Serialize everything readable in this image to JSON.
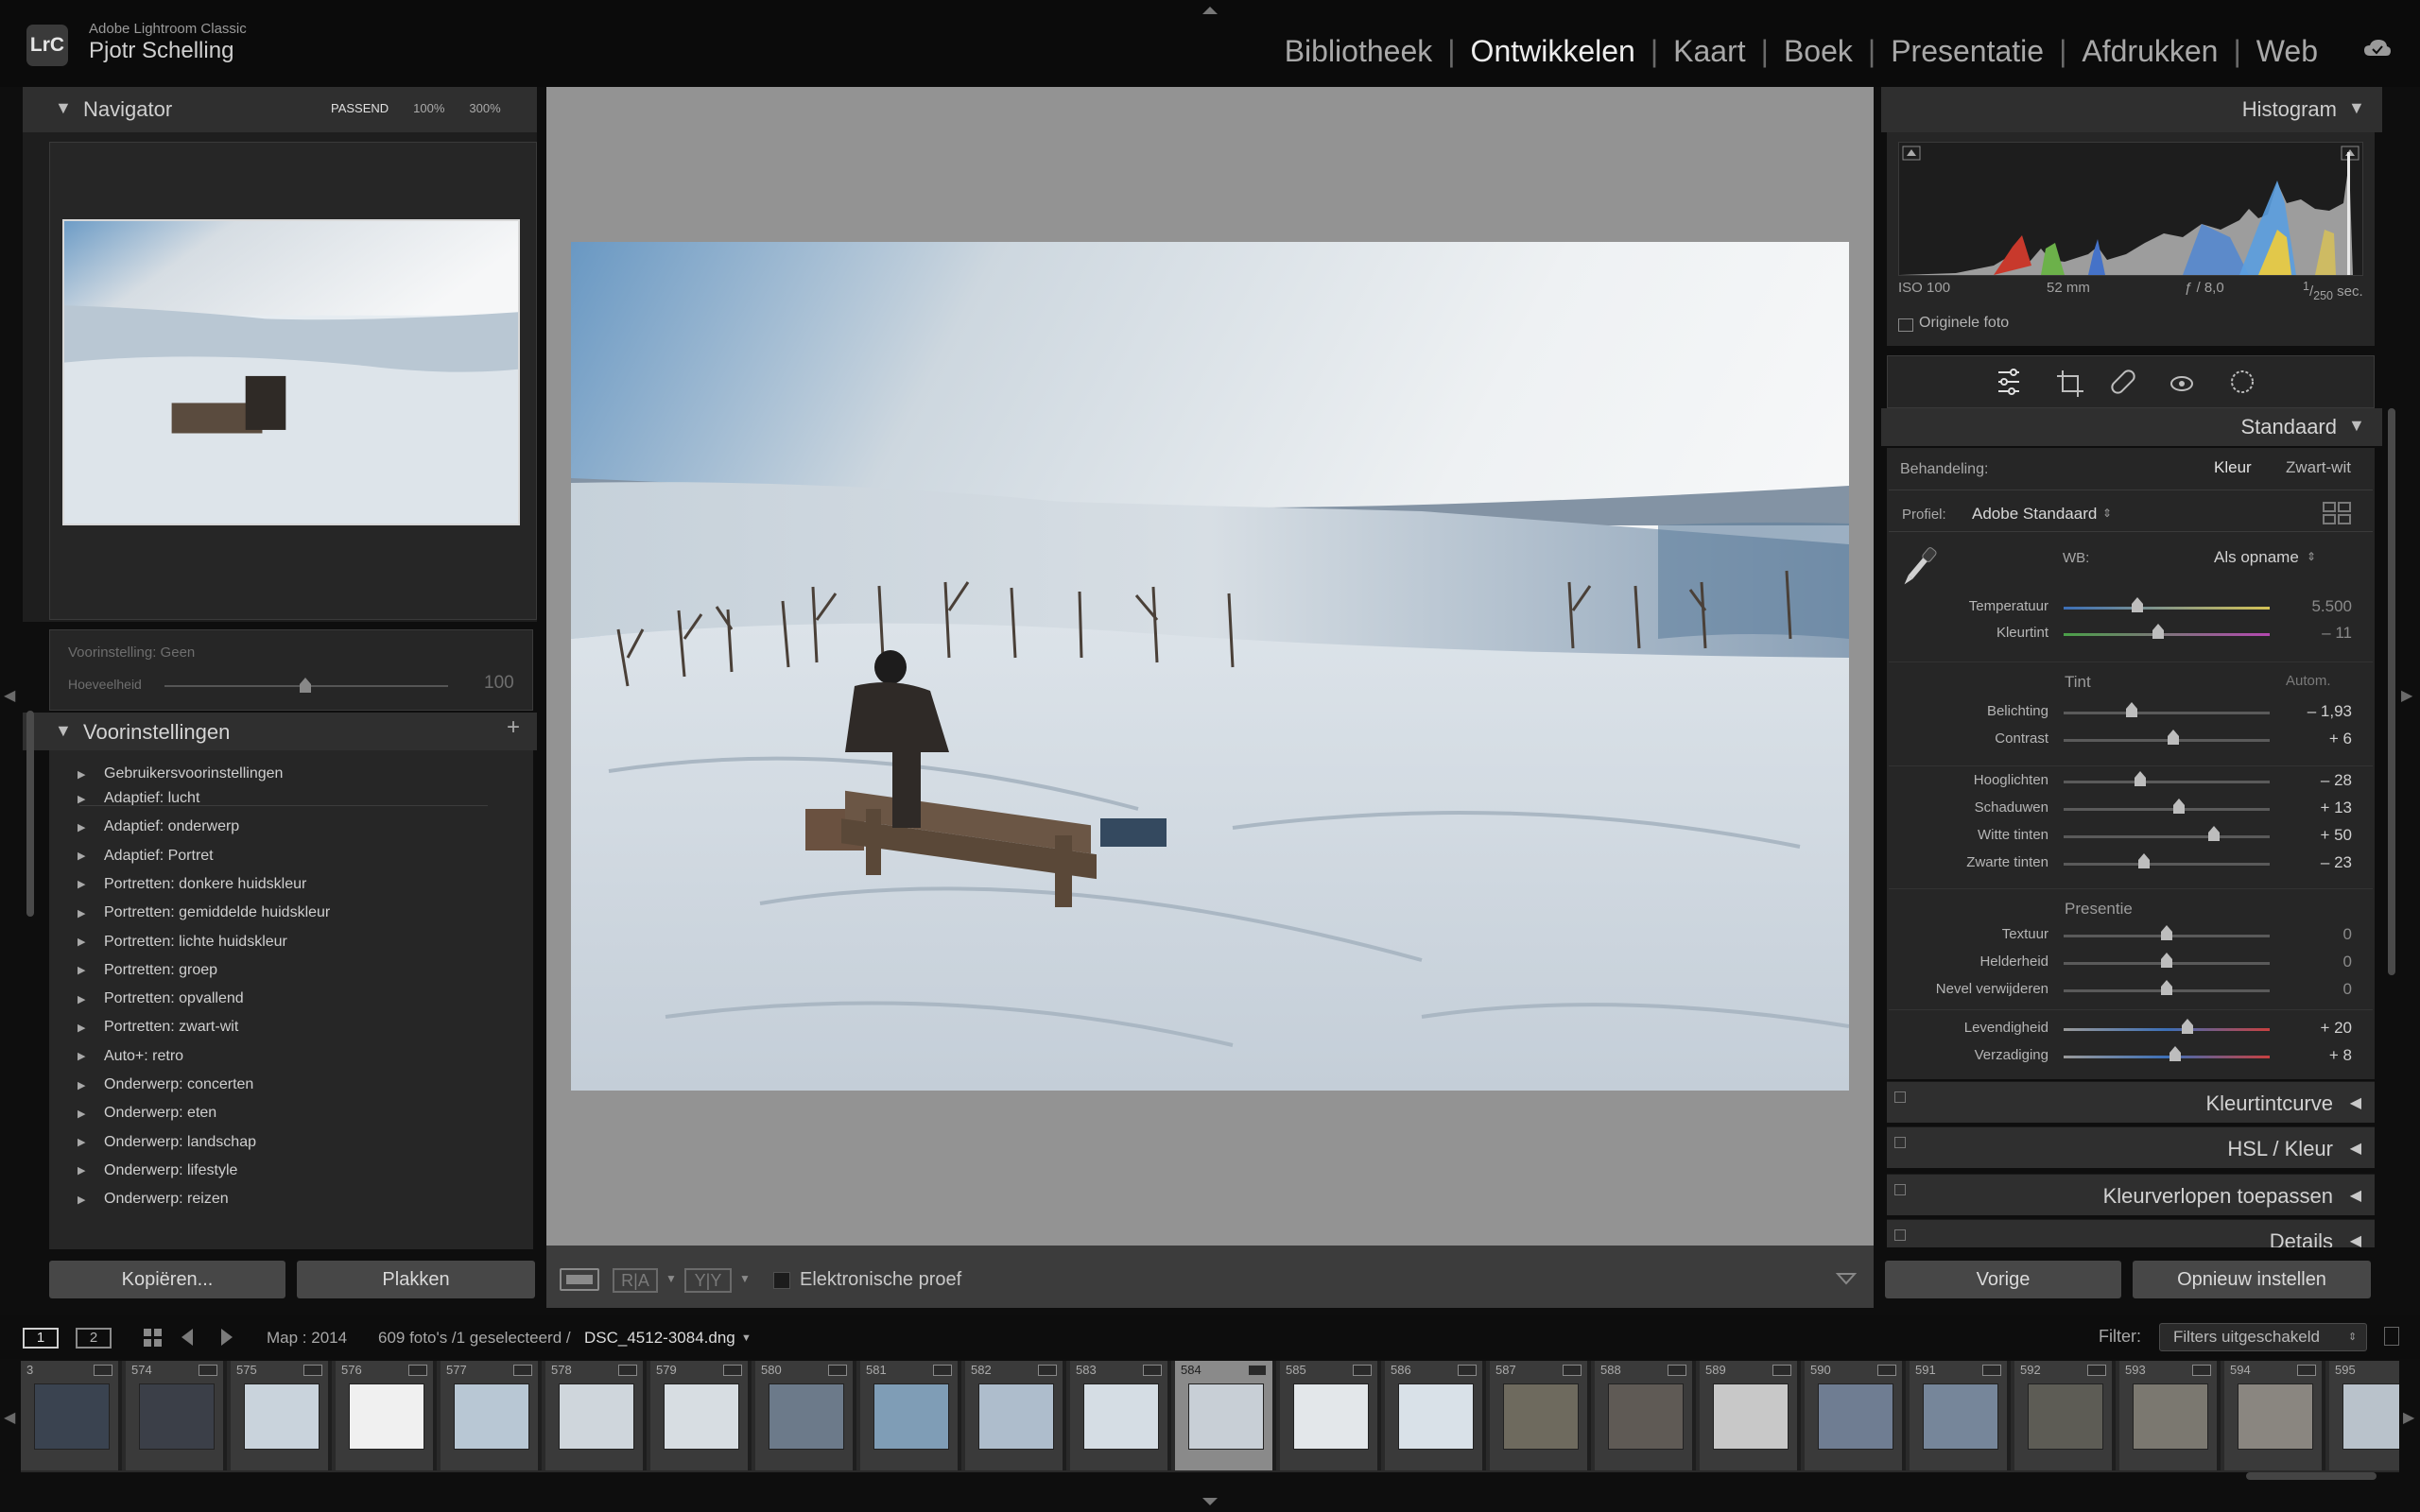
{
  "app": {
    "short": "LrC",
    "name": "Adobe Lightroom Classic",
    "user": "Pjotr Schelling"
  },
  "modules": [
    {
      "label": "Bibliotheek",
      "active": false
    },
    {
      "label": "Ontwikkelen",
      "active": true
    },
    {
      "label": "Kaart",
      "active": false
    },
    {
      "label": "Boek",
      "active": false
    },
    {
      "label": "Presentatie",
      "active": false
    },
    {
      "label": "Afdrukken",
      "active": false
    },
    {
      "label": "Web",
      "active": false
    }
  ],
  "navigator": {
    "title": "Navigator",
    "zoom": [
      "PASSEND",
      "100%",
      "300%"
    ]
  },
  "preset_amount": {
    "preset": "Voorinstelling: Geen",
    "label": "Hoeveelheid",
    "value": "100"
  },
  "presets": {
    "title": "Voorinstellingen",
    "group_top": "Gebruikersvoorinstellingen",
    "items": [
      "Adaptief: lucht",
      "Adaptief: onderwerp",
      "Adaptief: Portret",
      "Portretten: donkere huidskleur",
      "Portretten: gemiddelde huidskleur",
      "Portretten: lichte huidskleur",
      "Portretten: groep",
      "Portretten: opvallend",
      "Portretten: zwart-wit",
      "Auto+: retro",
      "Onderwerp: concerten",
      "Onderwerp: eten",
      "Onderwerp: landschap",
      "Onderwerp: lifestyle",
      "Onderwerp: reizen"
    ]
  },
  "left_buttons": {
    "copy": "Kopiëren...",
    "paste": "Plakken"
  },
  "toolbar": {
    "ra": "R|A",
    "yy": "Y|Y",
    "proof": "Elektronische proef"
  },
  "histogram": {
    "title": "Histogram",
    "iso": "ISO 100",
    "focal": "52 mm",
    "aperture": "ƒ / 8,0",
    "shutter_num": "1",
    "shutter_den": "250",
    "shutter_unit": "sec.",
    "original": "Originele foto"
  },
  "basic": {
    "title": "Standaard",
    "treatment_label": "Behandeling:",
    "treatment_color": "Kleur",
    "treatment_bw": "Zwart-wit",
    "profile_label": "Profiel:",
    "profile_value": "Adobe Standaard",
    "wb_label": "WB:",
    "wb_value": "Als opname",
    "tone_label": "Tint",
    "auto_label": "Autom.",
    "presence_label": "Presentie"
  },
  "sliders": [
    {
      "label": "Temperatuur",
      "value": "5.500",
      "pos": 0.36,
      "muted": true
    },
    {
      "label": "Kleurtint",
      "value": "– 11",
      "pos": 0.46,
      "muted": true
    },
    {
      "label": "Belichting",
      "value": "– 1,93",
      "pos": 0.33
    },
    {
      "label": "Contrast",
      "value": "+ 6",
      "pos": 0.53
    },
    {
      "label": "Hooglichten",
      "value": "– 28",
      "pos": 0.37
    },
    {
      "label": "Schaduwen",
      "value": "+ 13",
      "pos": 0.56
    },
    {
      "label": "Witte tinten",
      "value": "+ 50",
      "pos": 0.73
    },
    {
      "label": "Zwarte tinten",
      "value": "– 23",
      "pos": 0.39
    },
    {
      "label": "Textuur",
      "value": "0",
      "pos": 0.5,
      "muted": true
    },
    {
      "label": "Helderheid",
      "value": "0",
      "pos": 0.5,
      "muted": true
    },
    {
      "label": "Nevel verwijderen",
      "value": "0",
      "pos": 0.5,
      "muted": true
    },
    {
      "label": "Levendigheid",
      "value": "+ 20",
      "pos": 0.6
    },
    {
      "label": "Verzadiging",
      "value": "+ 8",
      "pos": 0.54
    }
  ],
  "collapsed_panels": [
    {
      "label": "Kleurtintcurve"
    },
    {
      "label": "HSL / Kleur"
    },
    {
      "label": "Kleurverlopen toepassen"
    },
    {
      "label": "Details"
    }
  ],
  "right_buttons": {
    "prev": "Vorige",
    "reset": "Opnieuw instellen"
  },
  "filmbar": {
    "page1": "1",
    "page2": "2",
    "source": "Map : 2014",
    "count": "609 foto's /1 geselecteerd /",
    "filename": "DSC_4512-3084.dng",
    "filter_label": "Filter:",
    "filter_value": "Filters uitgeschakeld"
  },
  "thumbs": [
    {
      "n": "3",
      "tone": "#3a4350",
      "sel": false
    },
    {
      "n": "574",
      "tone": "#3b3f48",
      "sel": false
    },
    {
      "n": "575",
      "tone": "#c9d3dc",
      "sel": false
    },
    {
      "n": "576",
      "tone": "#f0f0f0",
      "sel": false
    },
    {
      "n": "577",
      "tone": "#b8c7d4",
      "sel": false
    },
    {
      "n": "578",
      "tone": "#cfd6dc",
      "sel": false
    },
    {
      "n": "579",
      "tone": "#d7dde2",
      "sel": false
    },
    {
      "n": "580",
      "tone": "#6c7a8a",
      "sel": false
    },
    {
      "n": "581",
      "tone": "#7f9db6",
      "sel": false
    },
    {
      "n": "582",
      "tone": "#aebdcc",
      "sel": false
    },
    {
      "n": "583",
      "tone": "#d5dde4",
      "sel": false
    },
    {
      "n": "584",
      "tone": "#c8cfd6",
      "sel": true
    },
    {
      "n": "585",
      "tone": "#e3e7ea",
      "sel": false
    },
    {
      "n": "586",
      "tone": "#d9e1e8",
      "sel": false
    },
    {
      "n": "587",
      "tone": "#6e6a5e",
      "sel": false
    },
    {
      "n": "588",
      "tone": "#5f5a55",
      "sel": false
    },
    {
      "n": "589",
      "tone": "#c8c8c8",
      "sel": false
    },
    {
      "n": "590",
      "tone": "#6f7d92",
      "sel": false
    },
    {
      "n": "591",
      "tone": "#76869a",
      "sel": false
    },
    {
      "n": "592",
      "tone": "#5d5c55",
      "sel": false
    },
    {
      "n": "593",
      "tone": "#7b7870",
      "sel": false
    },
    {
      "n": "594",
      "tone": "#8a8680",
      "sel": false
    },
    {
      "n": "595",
      "tone": "#b9c2cb",
      "sel": false
    }
  ]
}
